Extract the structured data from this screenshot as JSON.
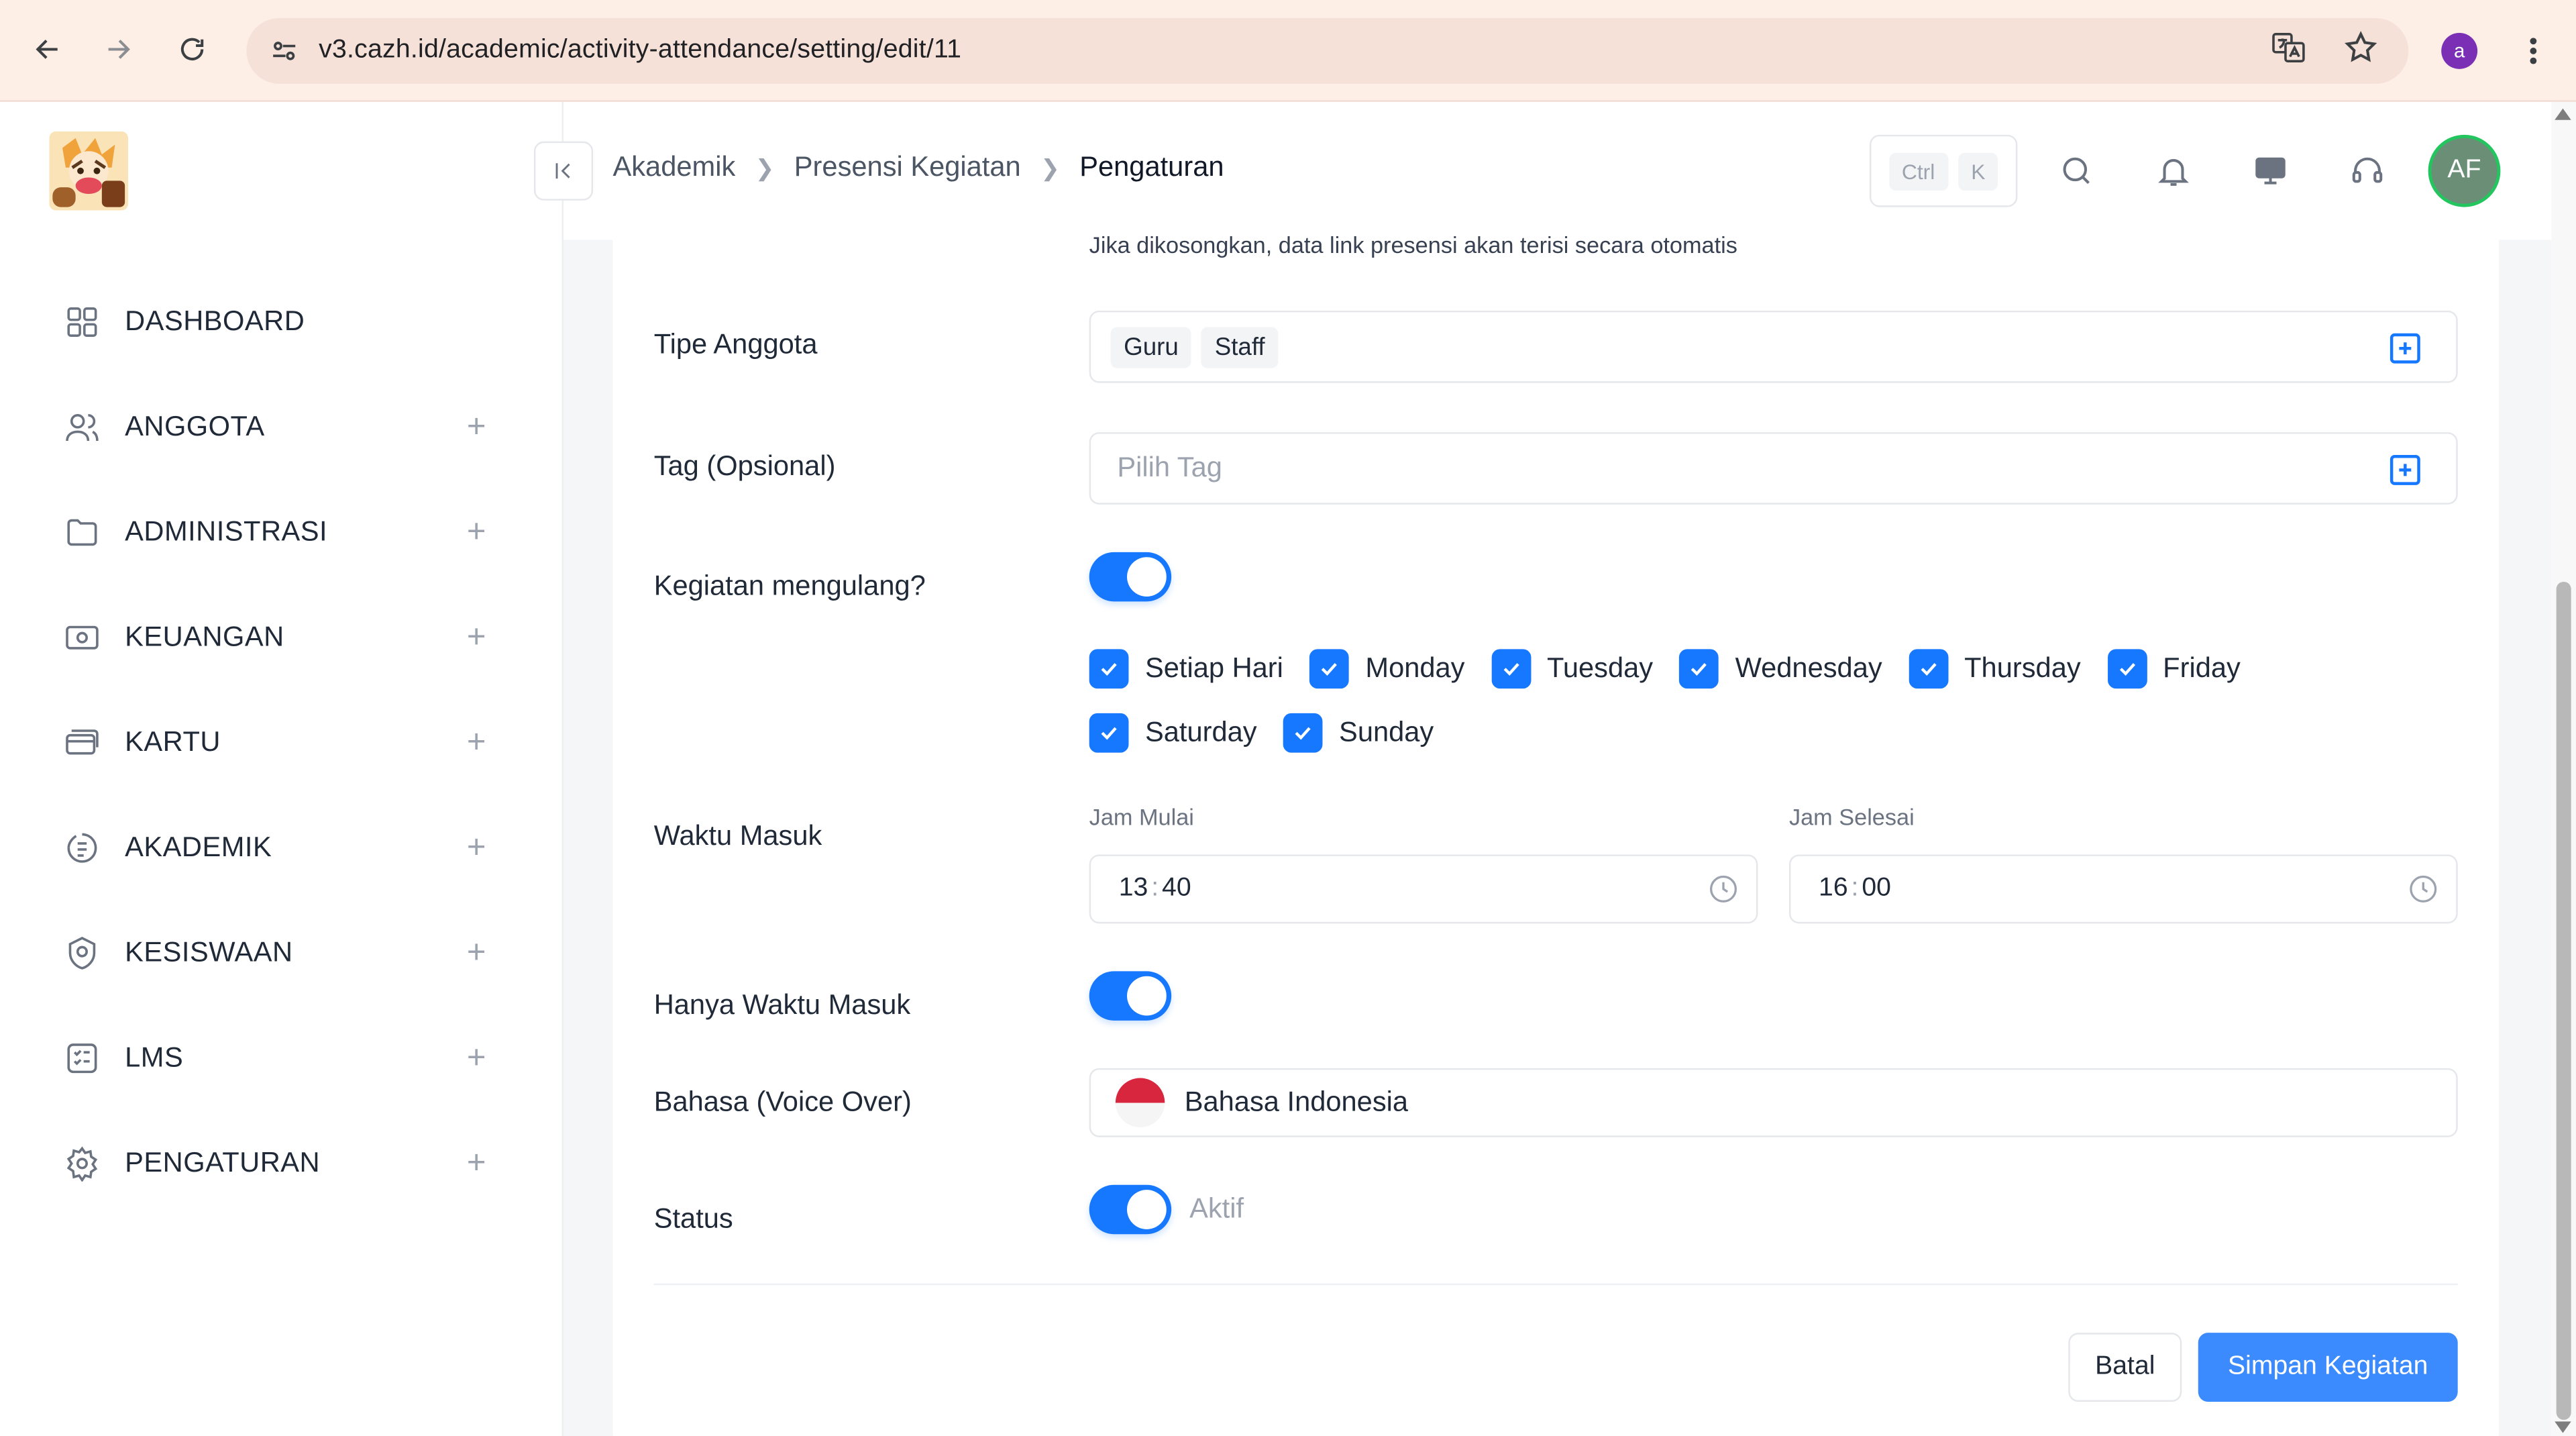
{
  "browser": {
    "url": "v3.cazh.id/academic/activity-attendance/setting/edit/11",
    "profile_initial": "a",
    "icons": [
      "back-icon",
      "forward-icon",
      "reload-icon",
      "site-settings-icon",
      "translate-icon",
      "star-icon",
      "menu-icon"
    ]
  },
  "sidebar": {
    "items": [
      {
        "label": "DASHBOARD",
        "icon": "grid-icon",
        "expandable": false
      },
      {
        "label": "ANGGOTA",
        "icon": "users-icon",
        "expandable": true
      },
      {
        "label": "ADMINISTRASI",
        "icon": "folder-icon",
        "expandable": true
      },
      {
        "label": "KEUANGAN",
        "icon": "money-icon",
        "expandable": true
      },
      {
        "label": "KARTU",
        "icon": "card-icon",
        "expandable": true
      },
      {
        "label": "AKADEMIK",
        "icon": "academic-icon",
        "expandable": true
      },
      {
        "label": "KESISWAAN",
        "icon": "student-icon",
        "expandable": true
      },
      {
        "label": "LMS",
        "icon": "checklist-icon",
        "expandable": true
      },
      {
        "label": "PENGATURAN",
        "icon": "settings-icon",
        "expandable": true
      }
    ],
    "plus_symbol": "+"
  },
  "header": {
    "breadcrumb": [
      "Akademik",
      "Presensi Kegiatan",
      "Pengaturan"
    ],
    "shortcut": {
      "ctrl": "Ctrl",
      "key": "K"
    },
    "avatar_initials": "AF"
  },
  "form": {
    "helper_text": "Jika dikosongkan, data link presensi akan terisi secara otomatis",
    "tipe_anggota": {
      "label": "Tipe Anggota",
      "chips": [
        "Guru",
        "Staff"
      ]
    },
    "tag": {
      "label": "Tag (Opsional)",
      "placeholder": "Pilih Tag"
    },
    "kegiatan_mengulang": {
      "label": "Kegiatan mengulang?",
      "enabled": true
    },
    "days_row1": [
      "Setiap Hari",
      "Monday",
      "Tuesday",
      "Wednesday",
      "Thursday",
      "Friday"
    ],
    "days_row2": [
      "Saturday",
      "Sunday"
    ],
    "waktu_masuk": {
      "label": "Waktu Masuk",
      "start_label": "Jam Mulai",
      "start_hour": "13",
      "start_minute": "40",
      "end_label": "Jam Selesai",
      "end_hour": "16",
      "end_minute": "00",
      "separator": ":"
    },
    "hanya_waktu_masuk": {
      "label": "Hanya Waktu Masuk",
      "enabled": true
    },
    "bahasa": {
      "label": "Bahasa (Voice Over)",
      "value": "Bahasa Indonesia"
    },
    "status": {
      "label": "Status",
      "value": "Aktif",
      "enabled": true
    }
  },
  "actions": {
    "cancel": "Batal",
    "save": "Simpan Kegiatan"
  },
  "colors": {
    "accent": "#1677ff",
    "save_button": "#3b8bff",
    "chrome_bg": "#fdeee6"
  }
}
